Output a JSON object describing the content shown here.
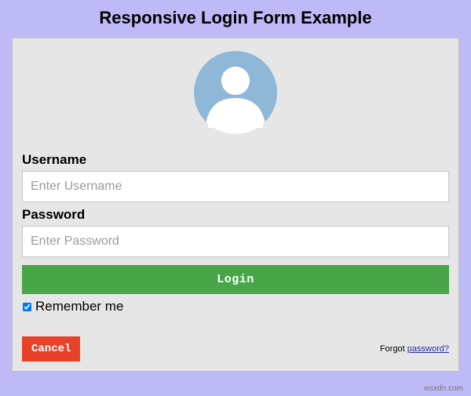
{
  "page": {
    "title": "Responsive Login Form Example"
  },
  "avatar": {
    "icon_name": "avatar-icon"
  },
  "form": {
    "username": {
      "label": "Username",
      "placeholder": "Enter Username",
      "value": ""
    },
    "password": {
      "label": "Password",
      "placeholder": "Enter Password",
      "value": ""
    },
    "login_button": "Login",
    "remember": {
      "label": "Remember me",
      "checked": true
    },
    "cancel_button": "Cancel",
    "forgot": {
      "prefix": "Forgot ",
      "link_text": "password?"
    }
  },
  "watermark": "wsxdn.com",
  "colors": {
    "page_bg": "#bebaf8",
    "card_bg": "#e6e6e6",
    "login_btn": "#48a648",
    "cancel_btn": "#e9402a",
    "avatar_circle": "#8fb7d8"
  }
}
